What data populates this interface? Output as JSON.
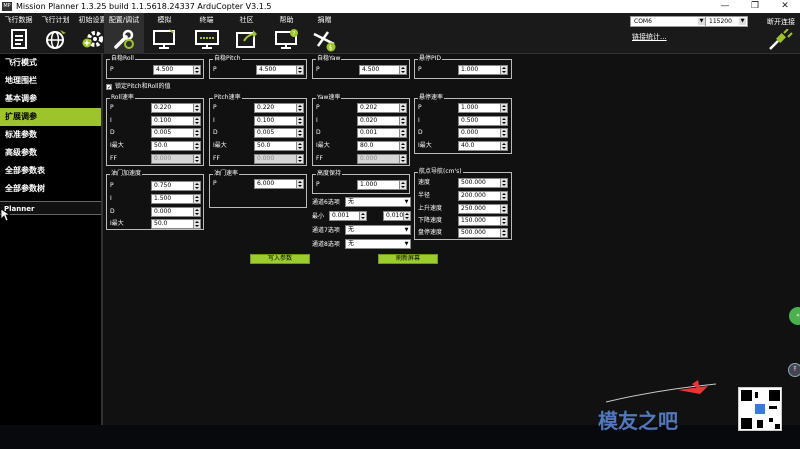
{
  "window": {
    "title": "Mission Planner 1.3.25 build 1.1.5618.24337 ArduCopter V3.1.5",
    "app_icon": "MP"
  },
  "menu": [
    {
      "label": "飞行数据",
      "icon": "document-icon"
    },
    {
      "label": "飞行计划",
      "icon": "globe-icon"
    },
    {
      "label": "初始设置",
      "icon": "gear-plus-icon"
    },
    {
      "label": "配置/调试",
      "icon": "wrench-icon"
    },
    {
      "label": "模拟",
      "icon": "monitor-plane-icon"
    },
    {
      "label": "终端",
      "icon": "terminal-icon"
    },
    {
      "label": "社区",
      "icon": "share-icon"
    },
    {
      "label": "帮助",
      "icon": "help-icon"
    },
    {
      "label": "捐赠",
      "icon": "donate-plane-icon"
    }
  ],
  "connection": {
    "port": "COM6",
    "baud": "115200",
    "stats_link": "链接统计...",
    "connect_label": "断开连接"
  },
  "sidebar": {
    "items": [
      {
        "label": "飞行模式"
      },
      {
        "label": "地理围栏"
      },
      {
        "label": "基本调参"
      },
      {
        "label": "扩展调参"
      },
      {
        "label": "标准参数"
      },
      {
        "label": "高级参数"
      },
      {
        "label": "全部参数表"
      },
      {
        "label": "全部参数树"
      }
    ],
    "planner_label": "Planner"
  },
  "panel": {
    "stab_roll": {
      "title": "自稳Roll",
      "p_label": "P",
      "p": "4.500"
    },
    "stab_pitch": {
      "title": "自稳Pitch",
      "p_label": "P",
      "p": "4.500"
    },
    "stab_yaw": {
      "title": "自稳Yaw",
      "p_label": "P",
      "p": "4.500"
    },
    "loiter_pid": {
      "title": "悬停PID",
      "p_label": "P",
      "p": "1.000"
    },
    "lock_label": "锁定Pitch和Roll的值",
    "rate_roll": {
      "title": "Roll速率",
      "labels": [
        "P",
        "I",
        "D",
        "I最大",
        "FF"
      ],
      "values": [
        "0.220",
        "0.100",
        "0.005",
        "50.0",
        "0.000"
      ]
    },
    "rate_pitch": {
      "title": "Pitch速率",
      "labels": [
        "P",
        "I",
        "D",
        "I最大",
        "FF"
      ],
      "values": [
        "0.220",
        "0.100",
        "0.005",
        "50.0",
        "0.000"
      ]
    },
    "rate_yaw": {
      "title": "Yaw速率",
      "labels": [
        "P",
        "I",
        "D",
        "I最大",
        "FF"
      ],
      "values": [
        "0.202",
        "0.020",
        "0.001",
        "80.0",
        "0.000"
      ]
    },
    "loiter_rate": {
      "title": "悬停速率",
      "labels": [
        "P",
        "I",
        "D",
        "I最大"
      ],
      "values": [
        "1.000",
        "0.500",
        "0.000",
        "40.0"
      ]
    },
    "throttle_accel": {
      "title": "油门加速度",
      "labels": [
        "P",
        "I",
        "D",
        "I最大"
      ],
      "values": [
        "0.750",
        "1.500",
        "0.000",
        "50.0"
      ]
    },
    "throttle_rate": {
      "title": "油门速率",
      "p_label": "P",
      "p": "6.000"
    },
    "alt_hold": {
      "title": "高度保持",
      "p_label": "P",
      "p": "1.000"
    },
    "ch6_label": "通道6选项",
    "ch6_value": "无",
    "min_label": "最小",
    "min_value": "0.001",
    "max_value": "0.010",
    "ch7_label": "通道7选项",
    "ch7_value": "无",
    "ch8_label": "通道8选项",
    "ch8_value": "无",
    "wpnav": {
      "title": "航点导航(cm's)",
      "labels": [
        "速度",
        "半径",
        "上升速度",
        "下降速度",
        "盘停速度"
      ],
      "values": [
        "500.000",
        "200.000",
        "250.000",
        "150.000",
        "500.000"
      ]
    },
    "write_params": "写入参数",
    "refresh_screen": "刷新屏幕"
  },
  "watermark": {
    "text": "模友之吧"
  }
}
